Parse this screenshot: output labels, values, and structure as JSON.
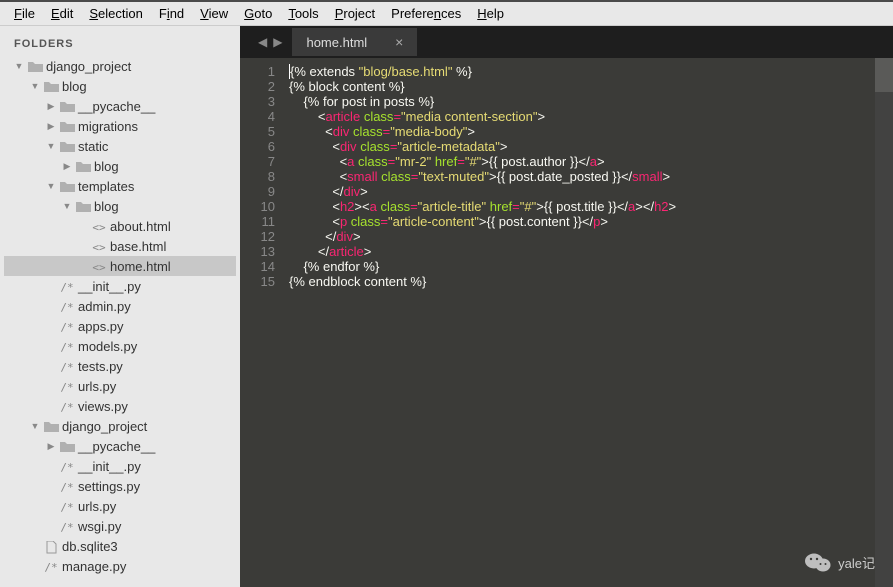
{
  "menu": {
    "items": [
      {
        "label": "File",
        "accel": "F"
      },
      {
        "label": "Edit",
        "accel": "E"
      },
      {
        "label": "Selection",
        "accel": "S"
      },
      {
        "label": "Find",
        "accel": "i"
      },
      {
        "label": "View",
        "accel": "V"
      },
      {
        "label": "Goto",
        "accel": "G"
      },
      {
        "label": "Tools",
        "accel": "T"
      },
      {
        "label": "Project",
        "accel": "P"
      },
      {
        "label": "Preferences",
        "accel": "n"
      },
      {
        "label": "Help",
        "accel": "H"
      }
    ]
  },
  "sidebar": {
    "header": "FOLDERS",
    "tree": [
      {
        "depth": 0,
        "arrow": "down",
        "icon": "folder",
        "label": "django_project"
      },
      {
        "depth": 1,
        "arrow": "down",
        "icon": "folder",
        "label": "blog"
      },
      {
        "depth": 2,
        "arrow": "right",
        "icon": "folder",
        "label": "__pycache__"
      },
      {
        "depth": 2,
        "arrow": "right",
        "icon": "folder",
        "label": "migrations"
      },
      {
        "depth": 2,
        "arrow": "down",
        "icon": "folder",
        "label": "static"
      },
      {
        "depth": 3,
        "arrow": "right",
        "icon": "folder",
        "label": "blog"
      },
      {
        "depth": 2,
        "arrow": "down",
        "icon": "folder",
        "label": "templates"
      },
      {
        "depth": 3,
        "arrow": "down",
        "icon": "folder",
        "label": "blog"
      },
      {
        "depth": 4,
        "arrow": "none",
        "icon": "html",
        "label": "about.html"
      },
      {
        "depth": 4,
        "arrow": "none",
        "icon": "html",
        "label": "base.html"
      },
      {
        "depth": 4,
        "arrow": "none",
        "icon": "html",
        "label": "home.html",
        "selected": true
      },
      {
        "depth": 2,
        "arrow": "none",
        "icon": "py",
        "label": "__init__.py"
      },
      {
        "depth": 2,
        "arrow": "none",
        "icon": "py",
        "label": "admin.py"
      },
      {
        "depth": 2,
        "arrow": "none",
        "icon": "py",
        "label": "apps.py"
      },
      {
        "depth": 2,
        "arrow": "none",
        "icon": "py",
        "label": "models.py"
      },
      {
        "depth": 2,
        "arrow": "none",
        "icon": "py",
        "label": "tests.py"
      },
      {
        "depth": 2,
        "arrow": "none",
        "icon": "py",
        "label": "urls.py"
      },
      {
        "depth": 2,
        "arrow": "none",
        "icon": "py",
        "label": "views.py"
      },
      {
        "depth": 1,
        "arrow": "down",
        "icon": "folder",
        "label": "django_project"
      },
      {
        "depth": 2,
        "arrow": "right",
        "icon": "folder",
        "label": "__pycache__"
      },
      {
        "depth": 2,
        "arrow": "none",
        "icon": "py",
        "label": "__init__.py"
      },
      {
        "depth": 2,
        "arrow": "none",
        "icon": "py",
        "label": "settings.py"
      },
      {
        "depth": 2,
        "arrow": "none",
        "icon": "py",
        "label": "urls.py"
      },
      {
        "depth": 2,
        "arrow": "none",
        "icon": "py",
        "label": "wsgi.py"
      },
      {
        "depth": 1,
        "arrow": "none",
        "icon": "file",
        "label": "db.sqlite3"
      },
      {
        "depth": 1,
        "arrow": "none",
        "icon": "py",
        "label": "manage.py"
      }
    ]
  },
  "tabs": {
    "active": {
      "label": "home.html"
    }
  },
  "editor": {
    "lines": [
      [
        {
          "t": "{% extends ",
          "c": "white"
        },
        {
          "t": "\"blog/base.html\"",
          "c": "str"
        },
        {
          "t": " %}",
          "c": "white"
        }
      ],
      [
        {
          "t": "{% block content %}",
          "c": "white"
        }
      ],
      [
        {
          "t": "    {% for post in posts %}",
          "c": "white"
        }
      ],
      [
        {
          "t": "        <",
          "c": "white"
        },
        {
          "t": "article",
          "c": "tag"
        },
        {
          "t": " ",
          "c": "white"
        },
        {
          "t": "class",
          "c": "attr"
        },
        {
          "t": "=",
          "c": "op"
        },
        {
          "t": "\"media content-section\"",
          "c": "str"
        },
        {
          "t": ">",
          "c": "white"
        }
      ],
      [
        {
          "t": "          <",
          "c": "white"
        },
        {
          "t": "div",
          "c": "tag"
        },
        {
          "t": " ",
          "c": "white"
        },
        {
          "t": "class",
          "c": "attr"
        },
        {
          "t": "=",
          "c": "op"
        },
        {
          "t": "\"media-body\"",
          "c": "str"
        },
        {
          "t": ">",
          "c": "white"
        }
      ],
      [
        {
          "t": "            <",
          "c": "white"
        },
        {
          "t": "div",
          "c": "tag"
        },
        {
          "t": " ",
          "c": "white"
        },
        {
          "t": "class",
          "c": "attr"
        },
        {
          "t": "=",
          "c": "op"
        },
        {
          "t": "\"article-metadata\"",
          "c": "str"
        },
        {
          "t": ">",
          "c": "white"
        }
      ],
      [
        {
          "t": "              <",
          "c": "white"
        },
        {
          "t": "a",
          "c": "tag"
        },
        {
          "t": " ",
          "c": "white"
        },
        {
          "t": "class",
          "c": "attr"
        },
        {
          "t": "=",
          "c": "op"
        },
        {
          "t": "\"mr-2\"",
          "c": "str"
        },
        {
          "t": " ",
          "c": "white"
        },
        {
          "t": "href",
          "c": "attr"
        },
        {
          "t": "=",
          "c": "op"
        },
        {
          "t": "\"#\"",
          "c": "str"
        },
        {
          "t": ">{{ post.author }}</",
          "c": "white"
        },
        {
          "t": "a",
          "c": "tag"
        },
        {
          "t": ">",
          "c": "white"
        }
      ],
      [
        {
          "t": "              <",
          "c": "white"
        },
        {
          "t": "small",
          "c": "tag"
        },
        {
          "t": " ",
          "c": "white"
        },
        {
          "t": "class",
          "c": "attr"
        },
        {
          "t": "=",
          "c": "op"
        },
        {
          "t": "\"text-muted\"",
          "c": "str"
        },
        {
          "t": ">{{ post.date_posted }}</",
          "c": "white"
        },
        {
          "t": "small",
          "c": "tag"
        },
        {
          "t": ">",
          "c": "white"
        }
      ],
      [
        {
          "t": "            </",
          "c": "white"
        },
        {
          "t": "div",
          "c": "tag"
        },
        {
          "t": ">",
          "c": "white"
        }
      ],
      [
        {
          "t": "            <",
          "c": "white"
        },
        {
          "t": "h2",
          "c": "tag"
        },
        {
          "t": "><",
          "c": "white"
        },
        {
          "t": "a",
          "c": "tag"
        },
        {
          "t": " ",
          "c": "white"
        },
        {
          "t": "class",
          "c": "attr"
        },
        {
          "t": "=",
          "c": "op"
        },
        {
          "t": "\"article-title\"",
          "c": "str"
        },
        {
          "t": " ",
          "c": "white"
        },
        {
          "t": "href",
          "c": "attr"
        },
        {
          "t": "=",
          "c": "op"
        },
        {
          "t": "\"#\"",
          "c": "str"
        },
        {
          "t": ">{{ post.title }}</",
          "c": "white"
        },
        {
          "t": "a",
          "c": "tag"
        },
        {
          "t": "></",
          "c": "white"
        },
        {
          "t": "h2",
          "c": "tag"
        },
        {
          "t": ">",
          "c": "white"
        }
      ],
      [
        {
          "t": "            <",
          "c": "white"
        },
        {
          "t": "p",
          "c": "tag"
        },
        {
          "t": " ",
          "c": "white"
        },
        {
          "t": "class",
          "c": "attr"
        },
        {
          "t": "=",
          "c": "op"
        },
        {
          "t": "\"article-content\"",
          "c": "str"
        },
        {
          "t": ">{{ post.content }}</",
          "c": "white"
        },
        {
          "t": "p",
          "c": "tag"
        },
        {
          "t": ">",
          "c": "white"
        }
      ],
      [
        {
          "t": "          </",
          "c": "white"
        },
        {
          "t": "div",
          "c": "tag"
        },
        {
          "t": ">",
          "c": "white"
        }
      ],
      [
        {
          "t": "        </",
          "c": "white"
        },
        {
          "t": "article",
          "c": "tag"
        },
        {
          "t": ">",
          "c": "white"
        }
      ],
      [
        {
          "t": "    {% endfor %}",
          "c": "white"
        }
      ],
      [
        {
          "t": "{% endblock content %}",
          "c": "white"
        }
      ]
    ]
  },
  "watermark": {
    "text": "yale记"
  }
}
